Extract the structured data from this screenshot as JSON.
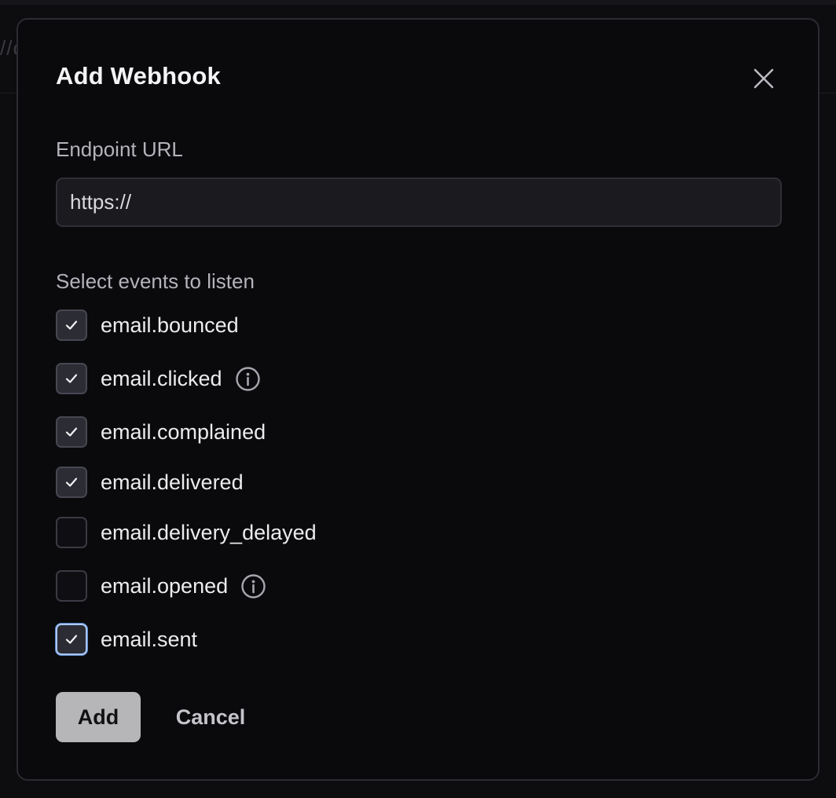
{
  "background": {
    "partial_text": "//c"
  },
  "dialog": {
    "title": "Add Webhook",
    "close_icon": "close-icon",
    "endpoint_label": "Endpoint URL",
    "endpoint_value": "https://",
    "events_label": "Select events to listen",
    "events": [
      {
        "name": "email.bounced",
        "checked": true,
        "info": false
      },
      {
        "name": "email.clicked",
        "checked": true,
        "info": true
      },
      {
        "name": "email.complained",
        "checked": true,
        "info": false
      },
      {
        "name": "email.delivered",
        "checked": true,
        "info": false
      },
      {
        "name": "email.delivery_delayed",
        "checked": false,
        "info": false
      },
      {
        "name": "email.opened",
        "checked": false,
        "info": true
      },
      {
        "name": "email.sent",
        "checked": true,
        "info": false,
        "focused": true
      }
    ],
    "add_label": "Add",
    "cancel_label": "Cancel"
  },
  "colors": {
    "dialog_bg": "#0a0a0d",
    "add_button_bg": "#b6b6b9",
    "focus_ring": "#a9c7f5"
  }
}
